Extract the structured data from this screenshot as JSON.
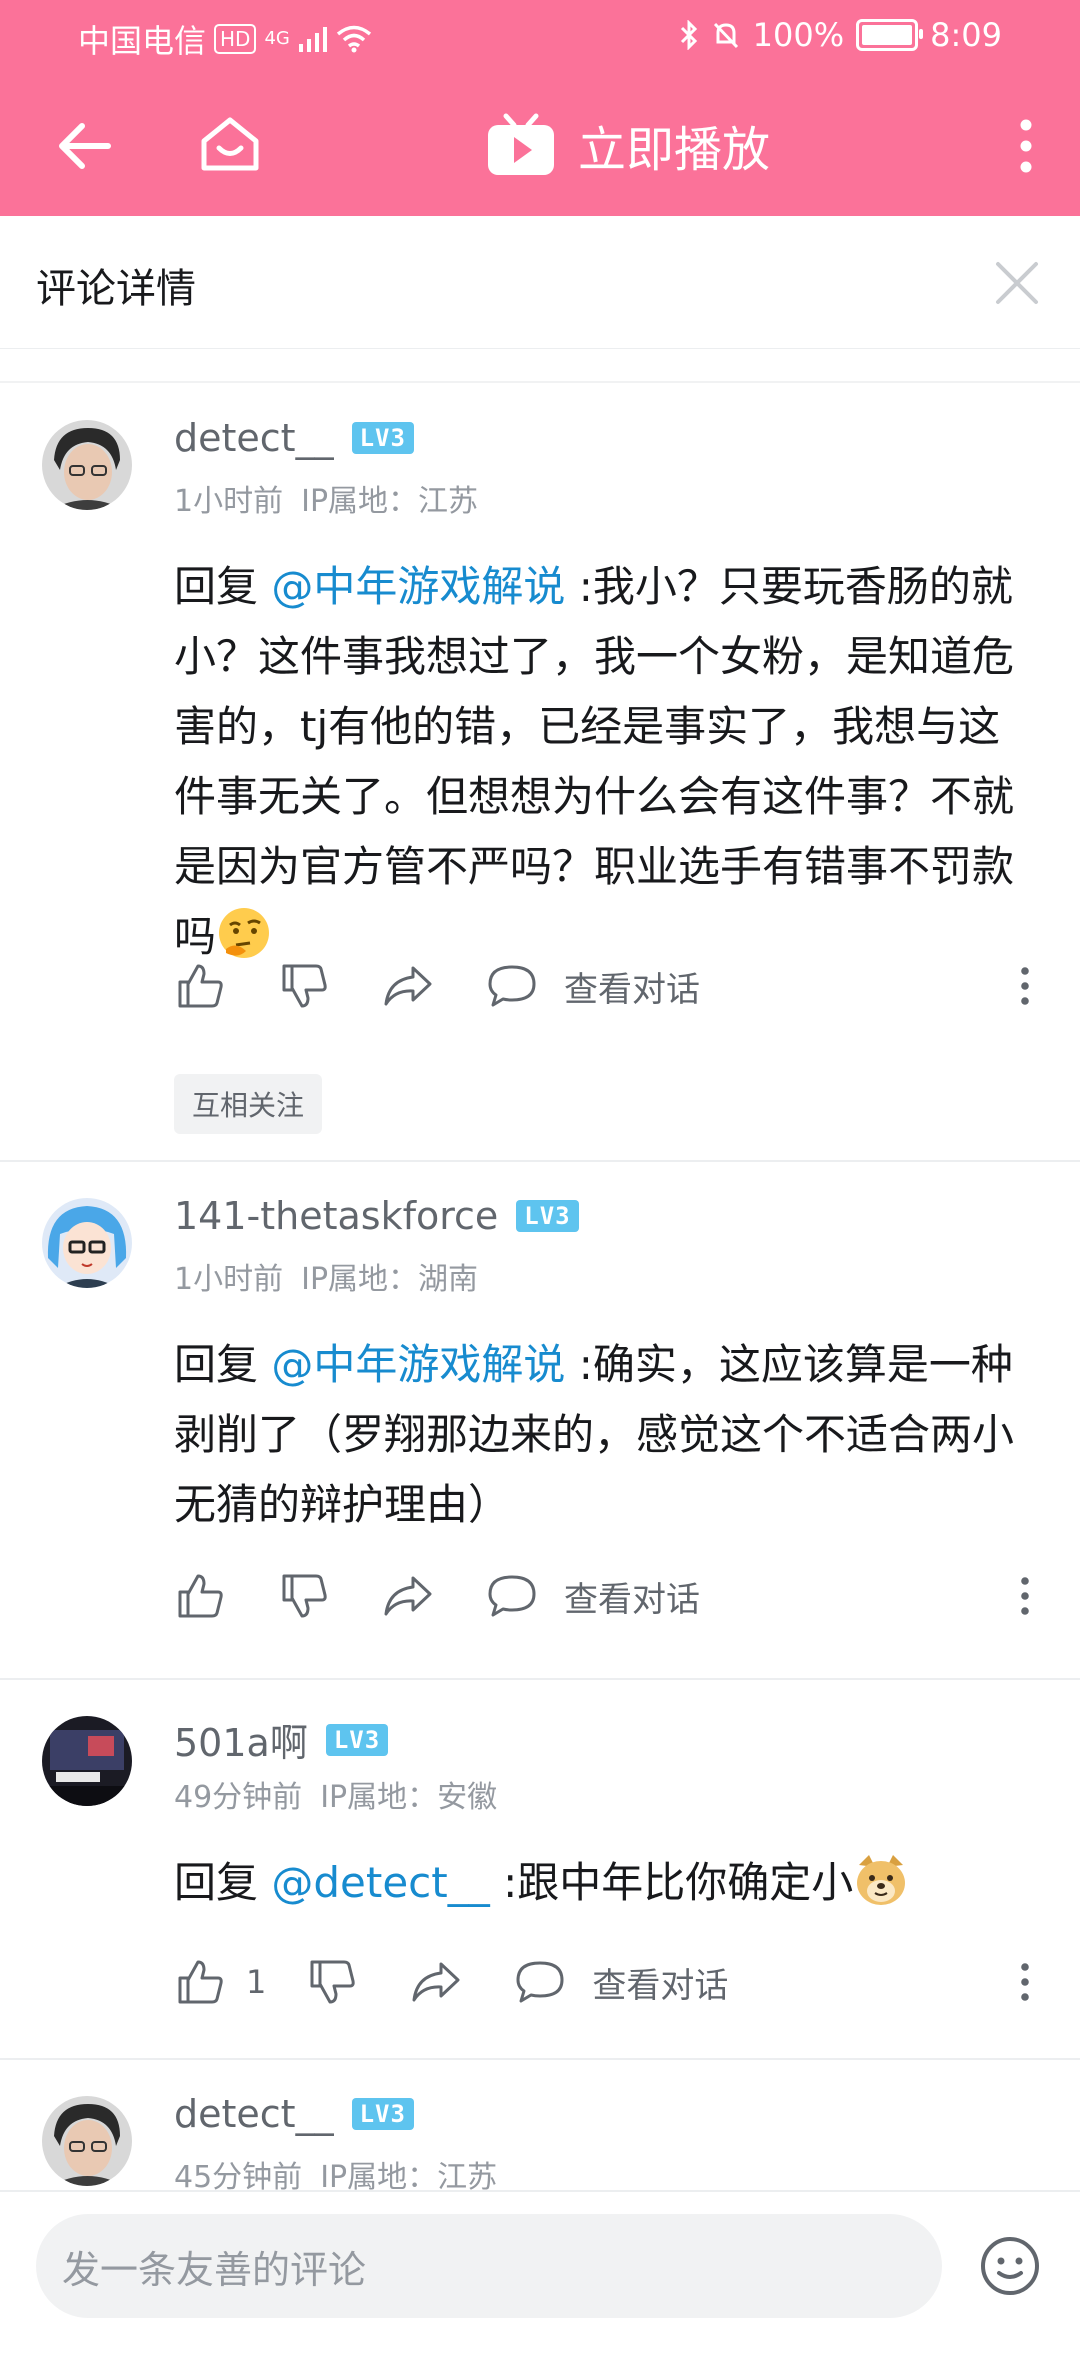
{
  "status_bar": {
    "carrier": "中国电信",
    "hd": "HD",
    "network": "4G",
    "battery_percent": "100%",
    "time": "8:09"
  },
  "app_bar": {
    "play_now_label": "立即播放",
    "colors": {
      "accent": "#fb7299"
    }
  },
  "detail_header": {
    "title": "评论详情"
  },
  "comments": [
    {
      "username": "detect__",
      "level": "LV3",
      "time": "1小时前",
      "ip": "IP属地：江苏",
      "reply_prefix": "回复",
      "mention": "@中年游戏解说",
      "text": ":我小？只要玩香肠的就小？这件事我想过了，我一个女粉，是知道危害的，tj有他的错，已经是事实了，我想与这件事无关了。但想想为什么会有这件事？不就是因为官方管不严吗？职业选手有错事不罚款吗",
      "emoji": "thinking-face-emoji",
      "likes": "",
      "view_conversation": "查看对话",
      "tag": "互相关注"
    },
    {
      "username": "141-thetaskforce",
      "level": "LV3",
      "time": "1小时前",
      "ip": "IP属地：湖南",
      "reply_prefix": "回复",
      "mention": "@中年游戏解说",
      "text": ":确实，这应该算是一种剥削了（罗翔那边来的，感觉这个不适合两小无猜的辩护理由）",
      "likes": "",
      "view_conversation": "查看对话"
    },
    {
      "username": "501a啊",
      "level": "LV3",
      "time": "49分钟前",
      "ip": "IP属地：安徽",
      "reply_prefix": "回复",
      "mention": "@detect__",
      "text": ":跟中年比你确定小",
      "emoji": "doge-emoji",
      "likes": "1",
      "view_conversation": "查看对话"
    },
    {
      "username": "detect__",
      "level": "LV3",
      "time": "45分钟前",
      "ip": "IP属地：江苏"
    }
  ],
  "input_bar": {
    "placeholder": "发一条友善的评论"
  }
}
